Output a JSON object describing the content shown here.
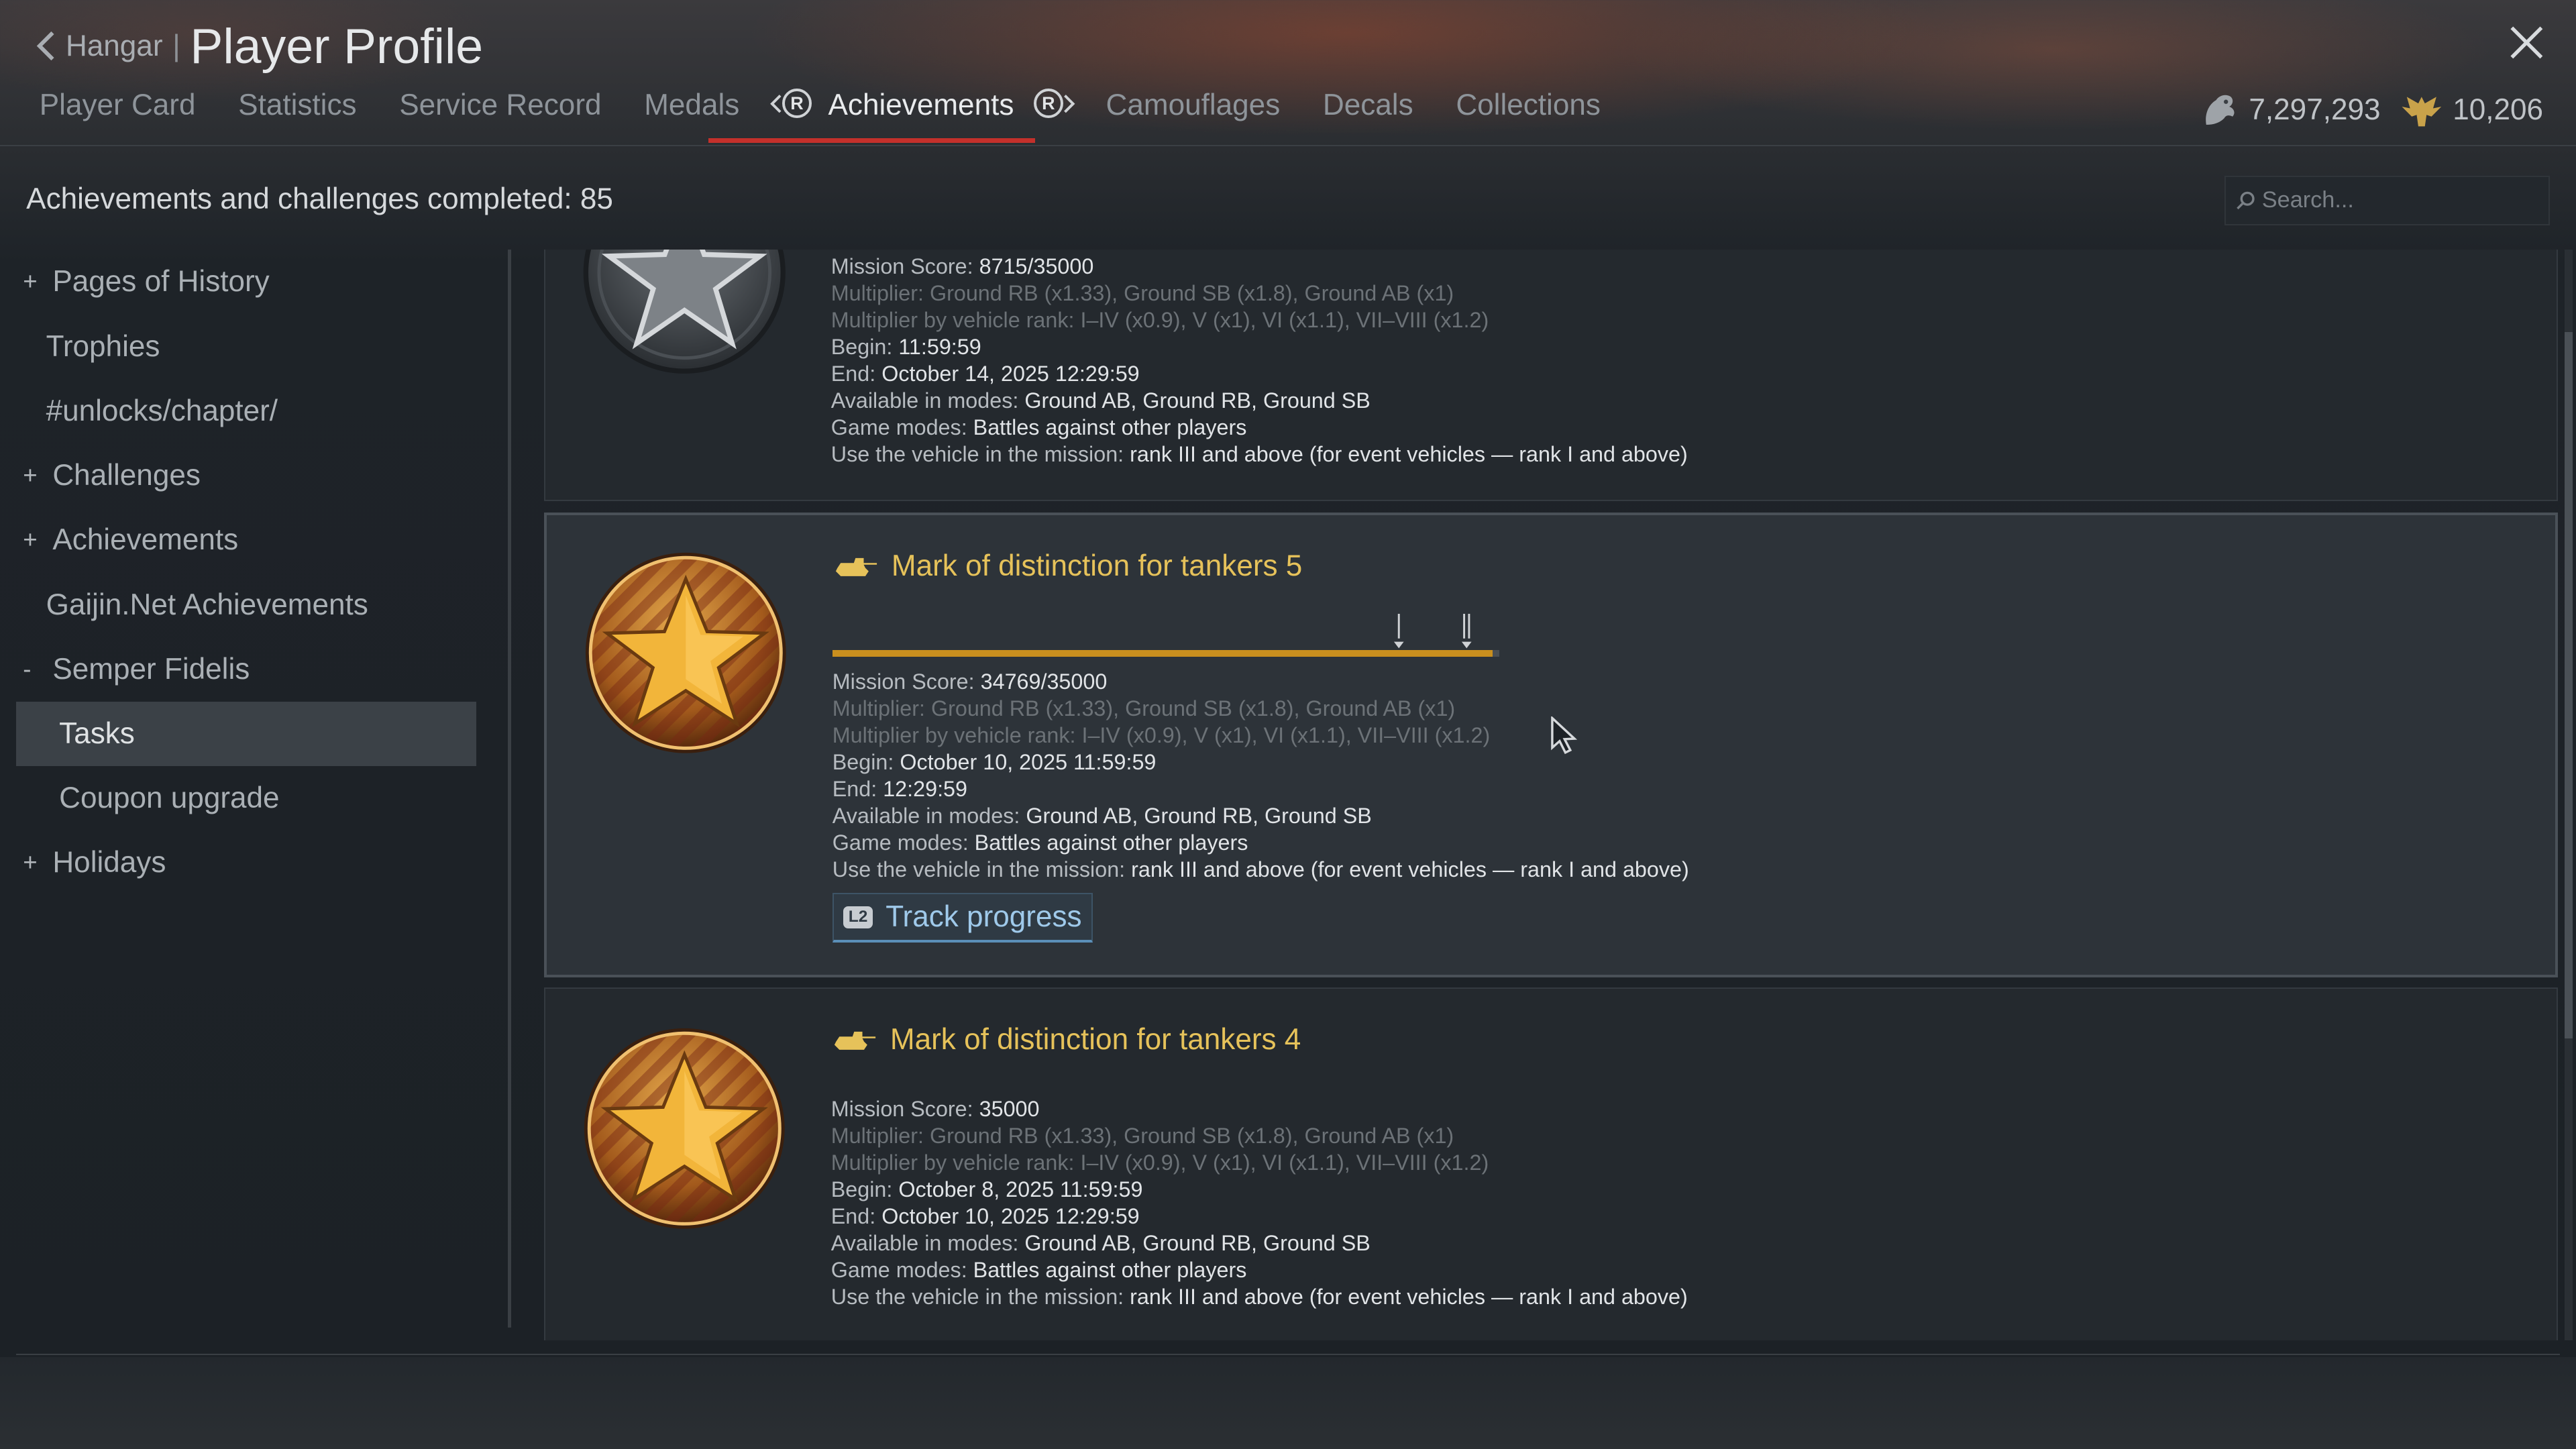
{
  "header": {
    "back_label": "Hangar",
    "separator": "|",
    "title": "Player Profile"
  },
  "tabs": [
    {
      "label": "Player Card"
    },
    {
      "label": "Statistics"
    },
    {
      "label": "Service Record"
    },
    {
      "label": "Medals"
    },
    {
      "label": "Achievements",
      "active": true
    },
    {
      "label": "Camouflages"
    },
    {
      "label": "Decals"
    },
    {
      "label": "Collections"
    }
  ],
  "gamepad": {
    "left_badge": "R",
    "right_badge": "R"
  },
  "currency": {
    "silver_lions": "7,297,293",
    "golden_eagles": "10,206"
  },
  "summary": {
    "completed_text": "Achievements and challenges completed: 85"
  },
  "search": {
    "placeholder": "Search..."
  },
  "sidebar": {
    "items": [
      {
        "label": "Pages of History",
        "prefix": "+"
      },
      {
        "label": "Trophies"
      },
      {
        "label": "#unlocks/chapter/"
      },
      {
        "label": "Challenges",
        "prefix": "+"
      },
      {
        "label": "Achievements",
        "prefix": "+"
      },
      {
        "label": "Gaijin.Net Achievements"
      },
      {
        "label": "Semper Fidelis",
        "prefix": "-"
      },
      {
        "label": "Tasks",
        "selected": true
      },
      {
        "label": "Coupon upgrade"
      },
      {
        "label": "Holidays",
        "prefix": "+"
      }
    ]
  },
  "cards": [
    {
      "mission_score_label": "Mission Score:",
      "mission_score": "8715/35000",
      "multiplier": "Multiplier: Ground RB (x1.33), Ground SB (x1.8), Ground AB (x1)",
      "multiplier_rank": "Multiplier by vehicle rank: I–IV (x0.9), V (x1), VI (x1.1), VII–VIII (x1.2)",
      "begin_label": "Begin:",
      "begin": "11:59:59",
      "end_label": "End:",
      "end": "October 14, 2025 12:29:59",
      "modes_label": "Available in modes:",
      "modes": "Ground AB, Ground RB, Ground SB",
      "game_modes_label": "Game modes:",
      "game_modes": "Battles against other players",
      "vehicle_label": "Use the vehicle in the mission:",
      "vehicle": "rank III and above (for event vehicles — rank I and above)"
    },
    {
      "title": "Mark of distinction for tankers 5",
      "progress": 0.99,
      "marker_1": "I",
      "marker_2": "II",
      "mission_score_label": "Mission Score:",
      "mission_score": "34769/35000",
      "multiplier": "Multiplier: Ground RB (x1.33), Ground SB (x1.8), Ground AB (x1)",
      "multiplier_rank": "Multiplier by vehicle rank: I–IV (x0.9), V (x1), VI (x1.1), VII–VIII (x1.2)",
      "begin_label": "Begin:",
      "begin": "October 10, 2025 11:59:59",
      "end_label": "End:",
      "end": "12:29:59",
      "modes_label": "Available in modes:",
      "modes": "Ground AB, Ground RB, Ground SB",
      "game_modes_label": "Game modes:",
      "game_modes": "Battles against other players",
      "vehicle_label": "Use the vehicle in the mission:",
      "vehicle": "rank III and above (for event vehicles — rank I and above)",
      "track_badge": "L2",
      "track_label": "Track progress"
    },
    {
      "title": "Mark of distinction for tankers 4",
      "mission_score_label": "Mission Score:",
      "mission_score": "35000",
      "multiplier": "Multiplier: Ground RB (x1.33), Ground SB (x1.8), Ground AB (x1)",
      "multiplier_rank": "Multiplier by vehicle rank: I–IV (x0.9), V (x1), VI (x1.1), VII–VIII (x1.2)",
      "begin_label": "Begin:",
      "begin": "October 8, 2025 11:59:59",
      "end_label": "End:",
      "end": "October 10, 2025 12:29:59",
      "modes_label": "Available in modes:",
      "modes": "Ground AB, Ground RB, Ground SB",
      "game_modes_label": "Game modes:",
      "game_modes": "Battles against other players",
      "vehicle_label": "Use the vehicle in the mission:",
      "vehicle": "rank III and above (for event vehicles — rank I and above)"
    }
  ],
  "colors": {
    "accent_red": "#c4302b",
    "title_gold": "#e6c25a",
    "progress_gold": "#c98f1e",
    "track_blue": "#9fc9ea"
  }
}
